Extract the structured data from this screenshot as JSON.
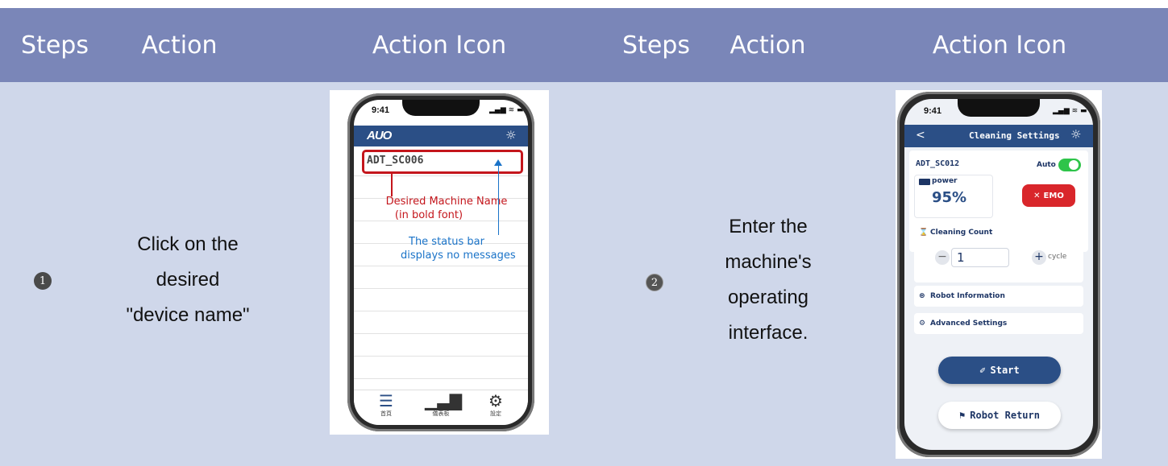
{
  "header": {
    "col1": "Steps",
    "col2": "Action",
    "col3": "Action Icon",
    "col4": "Steps",
    "col5": "Action",
    "col6": "Action Icon"
  },
  "row": {
    "step1": {
      "number": "1",
      "text_lines": [
        "Click on the",
        "desired",
        "\"device name\""
      ]
    },
    "step2": {
      "number": "2",
      "text_lines": [
        "Enter the",
        "machine's",
        "operating",
        "interface."
      ]
    }
  },
  "phone1": {
    "time": "9:41",
    "status_icons": "▂▄▆ ≋ ▬",
    "logo": "AUO",
    "settings_icon": "sun-icon",
    "machine_name": "ADT_SC006",
    "annotation_red": [
      "Desired Machine Name",
      "(in bold font)"
    ],
    "annotation_blue": [
      "The status bar",
      "displays no messages"
    ],
    "tabs": [
      {
        "label": "首頁",
        "icon": "list-icon"
      },
      {
        "label": "儀表板",
        "icon": "bar-chart-icon"
      },
      {
        "label": "設定",
        "icon": "gear-icon"
      }
    ],
    "colors": {
      "appbar": "#2b4f86",
      "highlight": "#c4161c",
      "annotation_blue": "#1a73c8"
    }
  },
  "phone2": {
    "time": "9:41",
    "status_icons": "▂▄▆ ≋ ▬",
    "back_icon": "<",
    "title": "Cleaning Settings",
    "device": "ADT_SC012",
    "auto_label": "Auto",
    "auto_on": true,
    "power_label": "power",
    "power_value": "95%",
    "emo_label": "EMO",
    "cleaning_count_label": "Cleaning Count",
    "cleaning_count_value": "1",
    "cycle_label": "cycle",
    "robot_info_label": "Robot Information",
    "advanced_settings_label": "Advanced Settings",
    "start_label": "Start",
    "robot_return_label": "Robot Return",
    "colors": {
      "appbar": "#2b4f86",
      "toggle": "#2ec44a",
      "emo": "#d9262b",
      "start": "#2b4f86"
    }
  }
}
